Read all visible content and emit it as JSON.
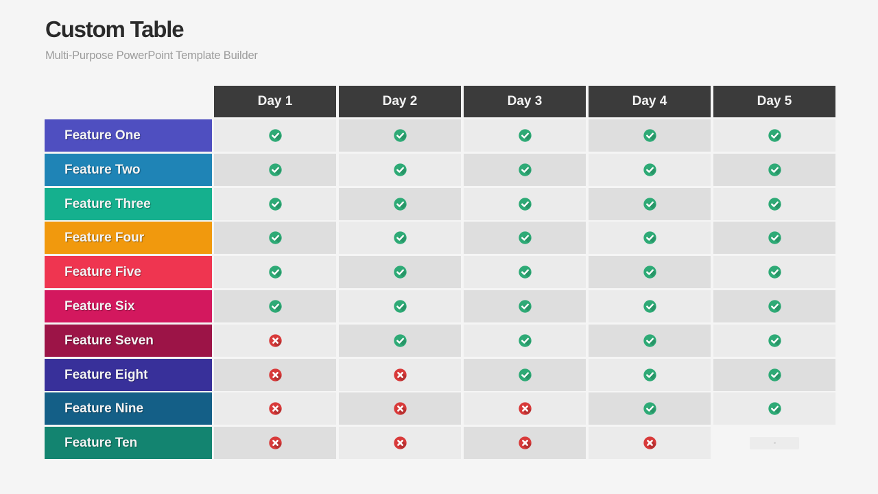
{
  "header": {
    "title": "Custom Table",
    "subtitle": "Multi-Purpose PowerPoint Template Builder"
  },
  "colors": {
    "header_bg": "#3b3b3b",
    "check": "#2eaa76",
    "cross": "#d83a3a",
    "cell_light": "#ebebeb",
    "cell_dark": "#dedede"
  },
  "table": {
    "columns": [
      "Day 1",
      "Day 2",
      "Day 3",
      "Day 4",
      "Day 5"
    ],
    "rows": [
      {
        "label": "Feature One",
        "color": "#4f4fc0",
        "values": [
          "check",
          "check",
          "check",
          "check",
          "check"
        ]
      },
      {
        "label": "Feature Two",
        "color": "#1f84b6",
        "values": [
          "check",
          "check",
          "check",
          "check",
          "check"
        ]
      },
      {
        "label": "Feature Three",
        "color": "#15b08e",
        "values": [
          "check",
          "check",
          "check",
          "check",
          "check"
        ]
      },
      {
        "label": "Feature Four",
        "color": "#f1990d",
        "values": [
          "check",
          "check",
          "check",
          "check",
          "check"
        ]
      },
      {
        "label": "Feature Five",
        "color": "#ef3550",
        "values": [
          "check",
          "check",
          "check",
          "check",
          "check"
        ]
      },
      {
        "label": "Feature Six",
        "color": "#d3185e",
        "values": [
          "check",
          "check",
          "check",
          "check",
          "check"
        ]
      },
      {
        "label": "Feature Seven",
        "color": "#9c1447",
        "values": [
          "cross",
          "check",
          "check",
          "check",
          "check"
        ]
      },
      {
        "label": "Feature Eight",
        "color": "#38309a",
        "values": [
          "cross",
          "cross",
          "check",
          "check",
          "check"
        ]
      },
      {
        "label": "Feature Nine",
        "color": "#145f87",
        "values": [
          "cross",
          "cross",
          "cross",
          "check",
          "check"
        ]
      },
      {
        "label": "Feature Ten",
        "color": "#138470",
        "values": [
          "cross",
          "cross",
          "cross",
          "cross",
          "empty"
        ]
      }
    ]
  }
}
